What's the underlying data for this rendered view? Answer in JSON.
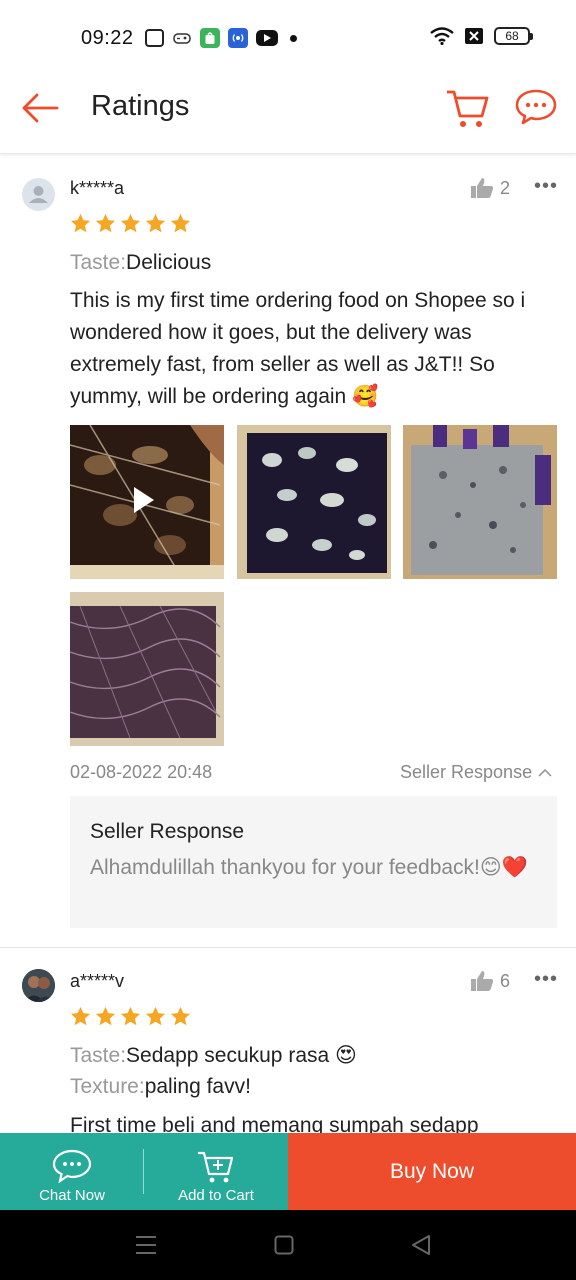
{
  "status_bar": {
    "time": "09:22",
    "battery": "68"
  },
  "header": {
    "title": "Ratings"
  },
  "reviews": [
    {
      "username": "k*****a",
      "likes": "2",
      "rating": 5,
      "attributes": [
        {
          "key": "Taste:",
          "value": "Delicious"
        }
      ],
      "text": "This is my first time ordering food on Shopee so i wondered how it goes, but the delivery was extremely fast, from seller as well as J&T!! So yummy, will be ordering again 🥰",
      "date": "02-08-2022 20:48",
      "seller_response_toggle": "Seller Response",
      "seller_response": {
        "title": "Seller Response",
        "text": "Alhamdulillah thankyou for your feedback!😊❤️"
      }
    },
    {
      "username": "a*****v",
      "likes": "6",
      "rating": 5,
      "attributes": [
        {
          "key": "Taste:",
          "value": "Sedapp secukup rasa 😍"
        },
        {
          "key": "Texture:",
          "value": "paling favv!"
        }
      ],
      "text": "First time beli and memang sumpah sedapp"
    }
  ],
  "bottom_bar": {
    "chat_label": "Chat Now",
    "cart_label": "Add to Cart",
    "buy_label": "Buy Now"
  },
  "colors": {
    "brand": "#ee4d2d",
    "teal": "#26aa99",
    "star": "#f5a623"
  }
}
